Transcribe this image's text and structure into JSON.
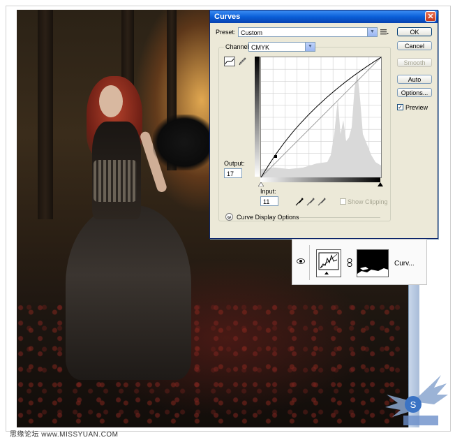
{
  "dialog": {
    "title": "Curves",
    "close_icon": "close-icon",
    "preset_label": "Preset:",
    "preset_value": "Custom",
    "channel_label": "Channel:",
    "channel_value": "CMYK",
    "output_label": "Output:",
    "output_value": "17",
    "input_label": "Input:",
    "input_value": "11",
    "show_clipping_label": "Show Clipping",
    "show_clipping_checked": false,
    "curve_display_options_label": "Curve Display Options",
    "buttons": {
      "ok": "OK",
      "cancel": "Cancel",
      "smooth": "Smooth",
      "auto": "Auto",
      "options": "Options..."
    },
    "preview_label": "Preview",
    "preview_checked": true,
    "icons": [
      "curve-tool-icon",
      "pencil-tool-icon",
      "preset-menu-icon",
      "black-eyedropper-icon",
      "gray-eyedropper-icon",
      "white-eyedropper-icon",
      "expand-options-icon"
    ]
  },
  "layers": {
    "layer_name": "Curv...",
    "icons": [
      "eye-icon",
      "curves-adjustment-icon",
      "link-icon",
      "layer-mask-thumbnail"
    ]
  },
  "watermark": {
    "text": "思缘论坛  www.MISSYUAN.COM",
    "logo_icon": "missyuan-logo-icon"
  },
  "colors": {
    "title_bar": "#0a5fd8",
    "dialog_bg": "#ece9d8",
    "close": "#c2351a"
  }
}
